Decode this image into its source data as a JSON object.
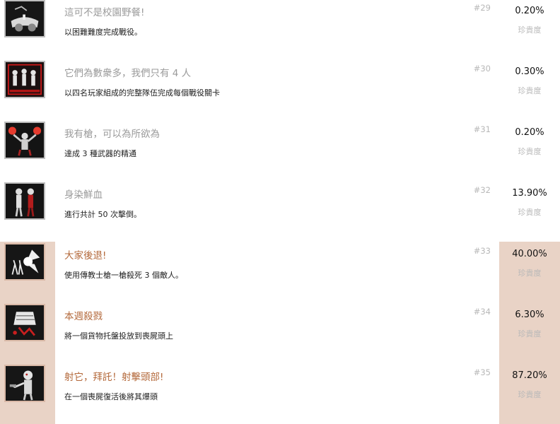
{
  "achievements": [
    {
      "icon": "picnic-achievement-icon",
      "title": "這可不是校園野餐!",
      "desc": "以困難難度完成戰役。",
      "num": "#29",
      "pct": "0.20%",
      "rarity_label": "珍貴度",
      "tier": "gray"
    },
    {
      "icon": "outnumbered-achievement-icon",
      "title": "它們為數衆多，我們只有 4 人",
      "desc": "以四名玩家組成的完整隊伍完成每個戰役關卡",
      "num": "#30",
      "pct": "0.30%",
      "rarity_label": "珍貴度",
      "tier": "gray"
    },
    {
      "icon": "guns-achievement-icon",
      "title": "我有槍，可以為所欲為",
      "desc": "達成 3 種武器的精通",
      "num": "#31",
      "pct": "0.20%",
      "rarity_label": "珍貴度",
      "tier": "gray"
    },
    {
      "icon": "bloodied-achievement-icon",
      "title": "身染鮮血",
      "desc": "進行共計 50 次擊倒。",
      "num": "#32",
      "pct": "13.90%",
      "rarity_label": "珍貴度",
      "tier": "gray"
    },
    {
      "icon": "stand-back-achievement-icon",
      "title": "大家後退!",
      "desc": "使用傳教士槍一槍殺死 3 個敵人。",
      "num": "#33",
      "pct": "40.00%",
      "rarity_label": "珍貴度",
      "tier": "peach"
    },
    {
      "icon": "pallet-crush-achievement-icon",
      "title": "本週殺戮",
      "desc": "將一個貨物托盤投放到喪屍頭上",
      "num": "#34",
      "pct": "6.30%",
      "rarity_label": "珍貴度",
      "tier": "peach"
    },
    {
      "icon": "headshot-achievement-icon",
      "title": "射它，拜託！射擊頭部!",
      "desc": "在一個喪屍復活後將其爆頭",
      "num": "#35",
      "pct": "87.20%",
      "rarity_label": "珍貴度",
      "tier": "peach"
    }
  ]
}
